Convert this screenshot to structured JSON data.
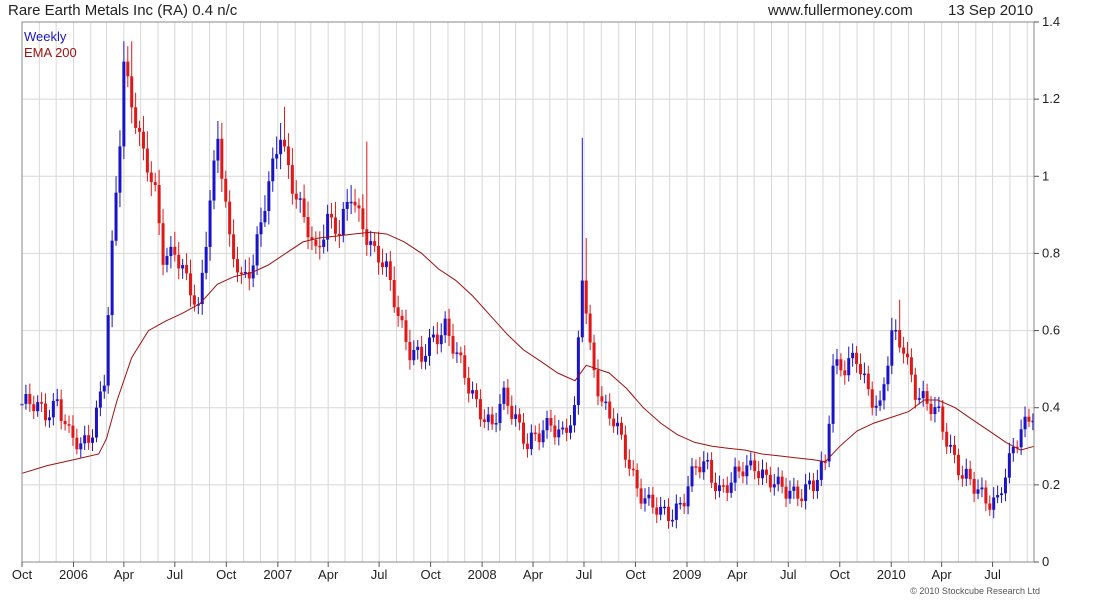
{
  "header": {
    "title": "Rare Earth Metals Inc (RA) 0.4 n/c",
    "site": "www.fullermoney.com",
    "date": "13 Sep 2010"
  },
  "copyright": "© 2010 Stockcube Research Ltd",
  "colors": {
    "up": "#1a14c8",
    "down": "#e01818",
    "ema": "#a01010",
    "grid": "#d8d8d8",
    "legend_weekly": "#1a14c8",
    "legend_ema": "#a01010"
  },
  "chart_data": {
    "type": "bar",
    "subtype": "weekly OHLC bars with EMA overlay",
    "legend": [
      "Weekly",
      "EMA 200"
    ],
    "legend_placement": "top-left",
    "grid": true,
    "y_axis": {
      "position": "right",
      "ylim": [
        0,
        1.4
      ],
      "ticks": [
        0,
        0.2,
        0.4,
        0.6,
        0.8,
        1,
        1.2,
        1.4
      ],
      "tick_labels": [
        "0",
        "0.2",
        "0.4",
        "0.6",
        "0.8",
        "1",
        "1.2",
        "1.4"
      ]
    },
    "x_axis": {
      "range": [
        "2005-10-01",
        "2010-09-13"
      ],
      "ticks": [
        {
          "date": "2005-10-01",
          "label": "Oct"
        },
        {
          "date": "2006-01-01",
          "label": "2006"
        },
        {
          "date": "2006-04-01",
          "label": "Apr"
        },
        {
          "date": "2006-07-01",
          "label": "Jul"
        },
        {
          "date": "2006-10-01",
          "label": "Oct"
        },
        {
          "date": "2007-01-01",
          "label": "2007"
        },
        {
          "date": "2007-04-01",
          "label": "Apr"
        },
        {
          "date": "2007-07-01",
          "label": "Jul"
        },
        {
          "date": "2007-10-01",
          "label": "Oct"
        },
        {
          "date": "2008-01-01",
          "label": "2008"
        },
        {
          "date": "2008-04-01",
          "label": "Apr"
        },
        {
          "date": "2008-07-01",
          "label": "Jul"
        },
        {
          "date": "2008-10-01",
          "label": "Oct"
        },
        {
          "date": "2009-01-01",
          "label": "2009"
        },
        {
          "date": "2009-04-01",
          "label": "Apr"
        },
        {
          "date": "2009-07-01",
          "label": "Jul"
        },
        {
          "date": "2009-10-01",
          "label": "Oct"
        },
        {
          "date": "2010-01-01",
          "label": "2010"
        },
        {
          "date": "2010-04-01",
          "label": "Apr"
        },
        {
          "date": "2010-07-01",
          "label": "Jul"
        }
      ]
    },
    "series": [
      {
        "name": "Weekly",
        "close_anchors": [
          [
            "2005-10-01",
            0.41
          ],
          [
            "2005-10-22",
            0.4
          ],
          [
            "2005-11-12",
            0.39
          ],
          [
            "2005-12-03",
            0.42
          ],
          [
            "2005-12-24",
            0.32
          ],
          [
            "2006-01-14",
            0.3
          ],
          [
            "2006-02-04",
            0.35
          ],
          [
            "2006-02-25",
            0.47
          ],
          [
            "2006-03-11",
            0.8
          ],
          [
            "2006-03-25",
            1.1
          ],
          [
            "2006-04-01",
            1.3
          ],
          [
            "2006-04-15",
            1.2
          ],
          [
            "2006-05-06",
            1.05
          ],
          [
            "2006-05-27",
            0.95
          ],
          [
            "2006-06-10",
            0.8
          ],
          [
            "2006-07-01",
            0.81
          ],
          [
            "2006-07-22",
            0.72
          ],
          [
            "2006-08-12",
            0.65
          ],
          [
            "2006-09-02",
            0.95
          ],
          [
            "2006-09-16",
            1.1
          ],
          [
            "2006-10-07",
            0.82
          ],
          [
            "2006-10-28",
            0.74
          ],
          [
            "2006-11-18",
            0.78
          ],
          [
            "2006-12-09",
            0.92
          ],
          [
            "2007-01-06",
            1.12
          ],
          [
            "2007-01-27",
            0.98
          ],
          [
            "2007-02-17",
            0.88
          ],
          [
            "2007-03-10",
            0.8
          ],
          [
            "2007-03-31",
            0.9
          ],
          [
            "2007-04-21",
            0.85
          ],
          [
            "2007-05-12",
            0.95
          ],
          [
            "2007-06-02",
            0.88
          ],
          [
            "2007-06-23",
            0.8
          ],
          [
            "2007-07-14",
            0.75
          ],
          [
            "2007-08-04",
            0.65
          ],
          [
            "2007-08-25",
            0.55
          ],
          [
            "2007-09-15",
            0.52
          ],
          [
            "2007-10-06",
            0.58
          ],
          [
            "2007-10-27",
            0.62
          ],
          [
            "2007-11-17",
            0.53
          ],
          [
            "2007-12-08",
            0.45
          ],
          [
            "2007-12-29",
            0.4
          ],
          [
            "2008-01-19",
            0.35
          ],
          [
            "2008-02-09",
            0.42
          ],
          [
            "2008-03-01",
            0.38
          ],
          [
            "2008-03-22",
            0.31
          ],
          [
            "2008-04-12",
            0.32
          ],
          [
            "2008-05-03",
            0.36
          ],
          [
            "2008-05-24",
            0.34
          ],
          [
            "2008-06-14",
            0.38
          ],
          [
            "2008-06-28",
            0.74
          ],
          [
            "2008-07-12",
            0.55
          ],
          [
            "2008-08-02",
            0.42
          ],
          [
            "2008-08-23",
            0.36
          ],
          [
            "2008-09-13",
            0.28
          ],
          [
            "2008-10-04",
            0.2
          ],
          [
            "2008-10-25",
            0.15
          ],
          [
            "2008-11-15",
            0.12
          ],
          [
            "2008-12-06",
            0.13
          ],
          [
            "2008-12-27",
            0.17
          ],
          [
            "2009-01-17",
            0.24
          ],
          [
            "2009-02-07",
            0.25
          ],
          [
            "2009-02-28",
            0.19
          ],
          [
            "2009-03-21",
            0.2
          ],
          [
            "2009-04-11",
            0.24
          ],
          [
            "2009-05-02",
            0.26
          ],
          [
            "2009-05-23",
            0.21
          ],
          [
            "2009-06-13",
            0.19
          ],
          [
            "2009-07-04",
            0.19
          ],
          [
            "2009-07-25",
            0.18
          ],
          [
            "2009-08-15",
            0.19
          ],
          [
            "2009-09-05",
            0.26
          ],
          [
            "2009-09-19",
            0.52
          ],
          [
            "2009-10-10",
            0.5
          ],
          [
            "2009-10-31",
            0.52
          ],
          [
            "2009-11-21",
            0.45
          ],
          [
            "2009-12-12",
            0.4
          ],
          [
            "2010-01-02",
            0.58
          ],
          [
            "2010-01-23",
            0.56
          ],
          [
            "2010-02-13",
            0.45
          ],
          [
            "2010-03-06",
            0.4
          ],
          [
            "2010-03-27",
            0.38
          ],
          [
            "2010-04-17",
            0.3
          ],
          [
            "2010-05-08",
            0.22
          ],
          [
            "2010-05-29",
            0.19
          ],
          [
            "2010-06-19",
            0.17
          ],
          [
            "2010-07-10",
            0.16
          ],
          [
            "2010-07-31",
            0.25
          ],
          [
            "2010-08-21",
            0.35
          ],
          [
            "2010-09-13",
            0.4
          ]
        ],
        "spikes": [
          {
            "date": "2008-06-28",
            "high": 1.1
          },
          {
            "date": "2008-07-05",
            "high": 0.84
          },
          {
            "date": "2006-04-01",
            "high": 1.35
          },
          {
            "date": "2006-04-15",
            "high": 1.35
          },
          {
            "date": "2007-01-13",
            "high": 1.18
          },
          {
            "date": "2007-06-09",
            "high": 1.09
          },
          {
            "date": "2010-01-16",
            "high": 0.68
          }
        ]
      },
      {
        "name": "EMA 200",
        "points": [
          [
            "2005-10-01",
            0.23
          ],
          [
            "2005-11-15",
            0.25
          ],
          [
            "2006-01-01",
            0.265
          ],
          [
            "2006-02-15",
            0.28
          ],
          [
            "2006-03-01",
            0.32
          ],
          [
            "2006-03-20",
            0.42
          ],
          [
            "2006-04-15",
            0.53
          ],
          [
            "2006-05-15",
            0.6
          ],
          [
            "2006-06-15",
            0.625
          ],
          [
            "2006-07-15",
            0.645
          ],
          [
            "2006-08-15",
            0.67
          ],
          [
            "2006-09-15",
            0.72
          ],
          [
            "2006-10-15",
            0.74
          ],
          [
            "2006-11-15",
            0.75
          ],
          [
            "2006-12-15",
            0.77
          ],
          [
            "2007-01-15",
            0.8
          ],
          [
            "2007-02-15",
            0.83
          ],
          [
            "2007-03-15",
            0.84
          ],
          [
            "2007-04-15",
            0.845
          ],
          [
            "2007-05-15",
            0.85
          ],
          [
            "2007-06-15",
            0.855
          ],
          [
            "2007-07-15",
            0.85
          ],
          [
            "2007-08-15",
            0.83
          ],
          [
            "2007-09-15",
            0.8
          ],
          [
            "2007-10-15",
            0.76
          ],
          [
            "2007-11-15",
            0.73
          ],
          [
            "2007-12-15",
            0.69
          ],
          [
            "2008-01-15",
            0.64
          ],
          [
            "2008-02-15",
            0.59
          ],
          [
            "2008-03-15",
            0.55
          ],
          [
            "2008-04-15",
            0.52
          ],
          [
            "2008-05-15",
            0.49
          ],
          [
            "2008-06-15",
            0.47
          ],
          [
            "2008-07-05",
            0.51
          ],
          [
            "2008-08-15",
            0.49
          ],
          [
            "2008-09-15",
            0.45
          ],
          [
            "2008-10-15",
            0.4
          ],
          [
            "2008-11-15",
            0.36
          ],
          [
            "2008-12-15",
            0.33
          ],
          [
            "2009-01-15",
            0.31
          ],
          [
            "2009-02-15",
            0.3
          ],
          [
            "2009-03-15",
            0.295
          ],
          [
            "2009-04-15",
            0.29
          ],
          [
            "2009-05-15",
            0.28
          ],
          [
            "2009-06-15",
            0.275
          ],
          [
            "2009-07-15",
            0.27
          ],
          [
            "2009-08-15",
            0.265
          ],
          [
            "2009-09-05",
            0.26
          ],
          [
            "2009-10-01",
            0.3
          ],
          [
            "2009-11-01",
            0.34
          ],
          [
            "2009-12-01",
            0.36
          ],
          [
            "2010-01-01",
            0.375
          ],
          [
            "2010-02-01",
            0.39
          ],
          [
            "2010-03-01",
            0.42
          ],
          [
            "2010-03-25",
            0.42
          ],
          [
            "2010-04-25",
            0.4
          ],
          [
            "2010-05-25",
            0.37
          ],
          [
            "2010-06-25",
            0.34
          ],
          [
            "2010-07-25",
            0.31
          ],
          [
            "2010-08-20",
            0.29
          ],
          [
            "2010-09-13",
            0.3
          ]
        ]
      }
    ]
  }
}
